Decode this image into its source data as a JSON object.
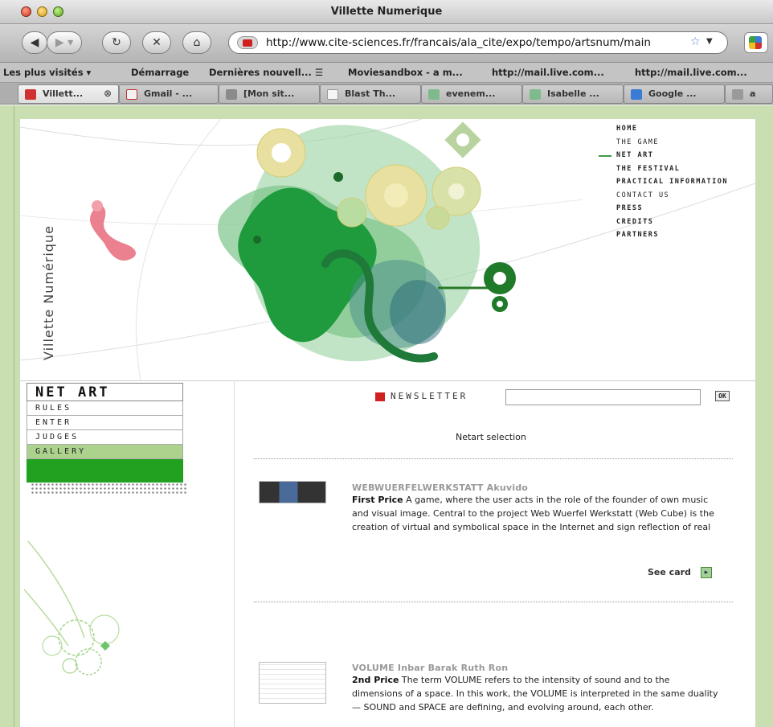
{
  "window": {
    "title": "Villette Numerique"
  },
  "navbar": {
    "url": "http://www.cite-sciences.fr/francais/ala_cite/expo/tempo/artsnum/main"
  },
  "bookmarks": [
    "Les plus visités ▾",
    "Démarrage",
    "Dernières nouvell... ☰",
    "Moviesandbox - a m...",
    "http://mail.live.com...",
    "http://mail.live.com..."
  ],
  "tabs": [
    {
      "label": "Villett...",
      "icon_color": "#d03030",
      "active": true
    },
    {
      "label": "Gmail - ...",
      "icon_color": "#d04040",
      "active": false
    },
    {
      "label": "[Mon sit...",
      "icon_color": "#8a8a8a",
      "active": false
    },
    {
      "label": "Blast Th...",
      "icon_color": "#f5f5f5",
      "active": false
    },
    {
      "label": "evenem...",
      "icon_color": "#7fba8c",
      "active": false
    },
    {
      "label": "Isabelle ...",
      "icon_color": "#7fba8c",
      "active": false
    },
    {
      "label": "Google ...",
      "icon_color": "#3a7bd5",
      "active": false
    },
    {
      "label": "a",
      "icon_color": "#9a9a9a",
      "active": false
    }
  ],
  "site": {
    "vertical_title": "Villette Numérique",
    "menu": [
      "HOME",
      "THE GAME",
      "NET ART",
      "THE FESTIVAL",
      "PRACTICAL INFORMATION",
      "CONTACT US",
      "PRESS",
      "CREDITS",
      "PARTNERS"
    ],
    "menu_selected": "NET ART"
  },
  "subnav": {
    "heading": "NET ART",
    "items": [
      "RULES",
      "ENTER",
      "JUDGES",
      "GALLERY"
    ],
    "selected": "GALLERY"
  },
  "newsletter": {
    "label": "NEWSLETTER",
    "button": "OK",
    "input_value": ""
  },
  "selection_title": "Netart selection",
  "entries": [
    {
      "title": "WEBWUERFELWERKSTATT Akuvido",
      "prize": "First Price",
      "text": " A game, where the user acts in the role of the founder of own music and visual image. Central to the project Web Wuerfel Werkstatt (Web Cube) is the creation of virtual and symbolical space in the Internet and sign reflection of real",
      "see_card": "See card"
    },
    {
      "title": "VOLUME Inbar Barak Ruth Ron",
      "prize": "2nd Price",
      "text": " The term VOLUME refers to the intensity of sound and to the dimensions of a space. In this work, the VOLUME is interpreted in the same duality — SOUND and SPACE are defining, and evolving around, each other."
    }
  ],
  "colors": {
    "accent_green": "#22a020",
    "page_bg": "#c9deb1",
    "selected_green": "#abd38e",
    "newsletter_red": "#d02020"
  }
}
